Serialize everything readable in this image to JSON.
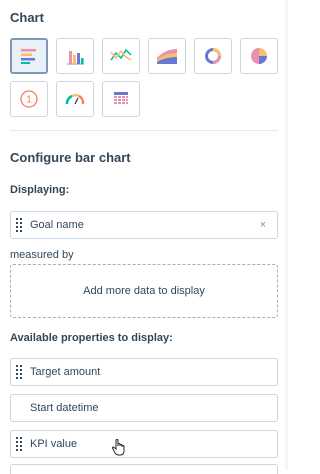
{
  "chart_section": {
    "title": "Chart",
    "types": [
      {
        "icon": "horizontal-bar-chart-icon",
        "selected": true
      },
      {
        "icon": "vertical-bar-chart-icon",
        "selected": false
      },
      {
        "icon": "line-chart-icon",
        "selected": false
      },
      {
        "icon": "area-chart-icon",
        "selected": false
      },
      {
        "icon": "donut-chart-icon",
        "selected": false
      },
      {
        "icon": "pie-chart-icon",
        "selected": false
      },
      {
        "icon": "single-value-icon",
        "selected": false,
        "label": "1"
      },
      {
        "icon": "gauge-icon",
        "selected": false
      },
      {
        "icon": "table-icon",
        "selected": false
      }
    ]
  },
  "configure": {
    "title": "Configure bar chart",
    "displaying_label": "Displaying:",
    "displaying_field": {
      "value": "Goal name",
      "clear_label": "×"
    },
    "measured_by_label": "measured by",
    "dropzone_text": "Add more data to display",
    "available_label": "Available properties to display:",
    "properties": [
      "Target amount",
      "Start datetime",
      "KPI value"
    ]
  },
  "colors": {
    "text": "#33475b",
    "border": "#cbd6e2",
    "selected_bg": "#eaf0f6",
    "orange": "#ff7a59",
    "teal": "#00bda5",
    "blue": "#516f90",
    "purple": "#6a78d1",
    "yellow": "#f5c26b",
    "pink": "#ea90b1"
  }
}
